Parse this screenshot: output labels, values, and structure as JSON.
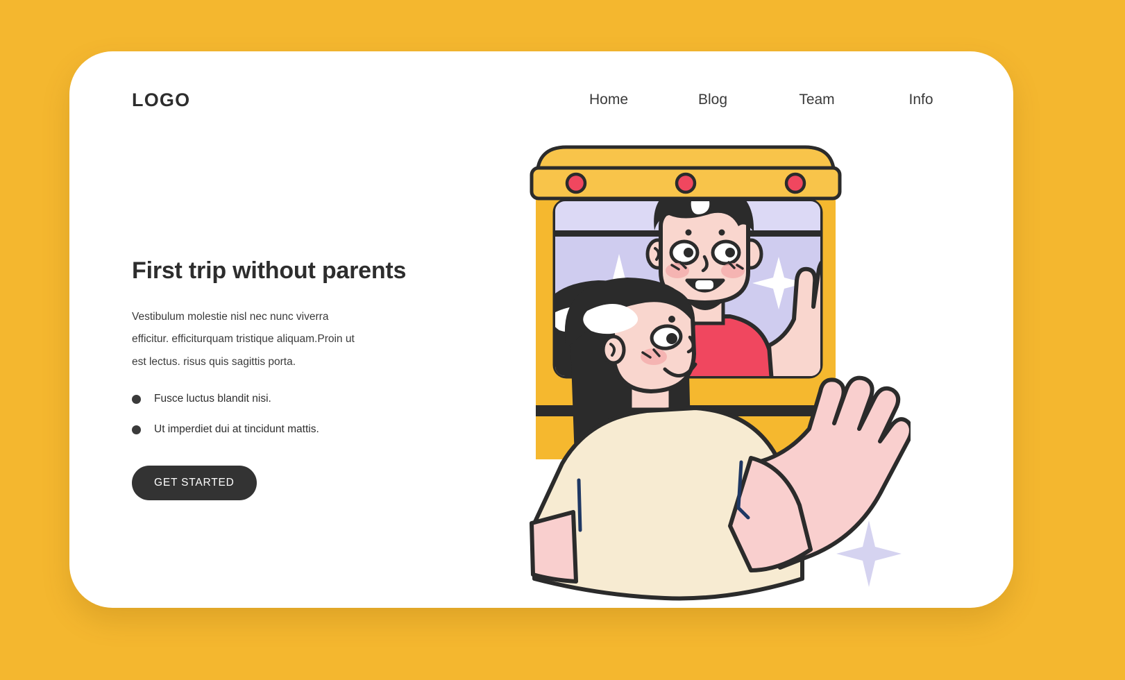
{
  "page": {
    "background_color": "#F4B72F",
    "card_color": "#FFFFFF"
  },
  "header": {
    "logo": "LOGO",
    "nav": [
      {
        "label": "Home",
        "name": "nav-link-home"
      },
      {
        "label": "Blog",
        "name": "nav-link-blog"
      },
      {
        "label": "Team",
        "name": "nav-link-team"
      },
      {
        "label": "Info",
        "name": "nav-link-info"
      }
    ]
  },
  "hero": {
    "title": "First trip without parents",
    "paragraph": "Vestibulum molestie nisl nec nunc viverra efficitur. efficiturquam tristique aliquam.Proin ut est lectus. risus quis sagittis porta.",
    "bullets": [
      "Fusce luctus blandit nisi.",
      "Ut imperdiet dui at tincidunt mattis."
    ],
    "cta_label": "GET STARTED"
  },
  "illustration": {
    "name": "school-bus-kids-waving-illustration",
    "colors": {
      "bus_yellow": "#F5B82F",
      "bus_roof_yellow": "#F8C44A",
      "outline_dark": "#2B2B2B",
      "window_lavender": "#CFCCEF",
      "window_lavender_light": "#DCD9F5",
      "light_red": "#F0475F",
      "boy_shirt_red": "#F0475F",
      "skin": "#F9D6CE",
      "skin_light": "#FBDDD4",
      "hair_black": "#2B2B2B",
      "girl_shirt_cream": "#F7EBD2",
      "sparkle_white": "#FFFFFF",
      "sparkle_lavender": "#D5D3F0",
      "accent_navy": "#1F3864"
    }
  }
}
